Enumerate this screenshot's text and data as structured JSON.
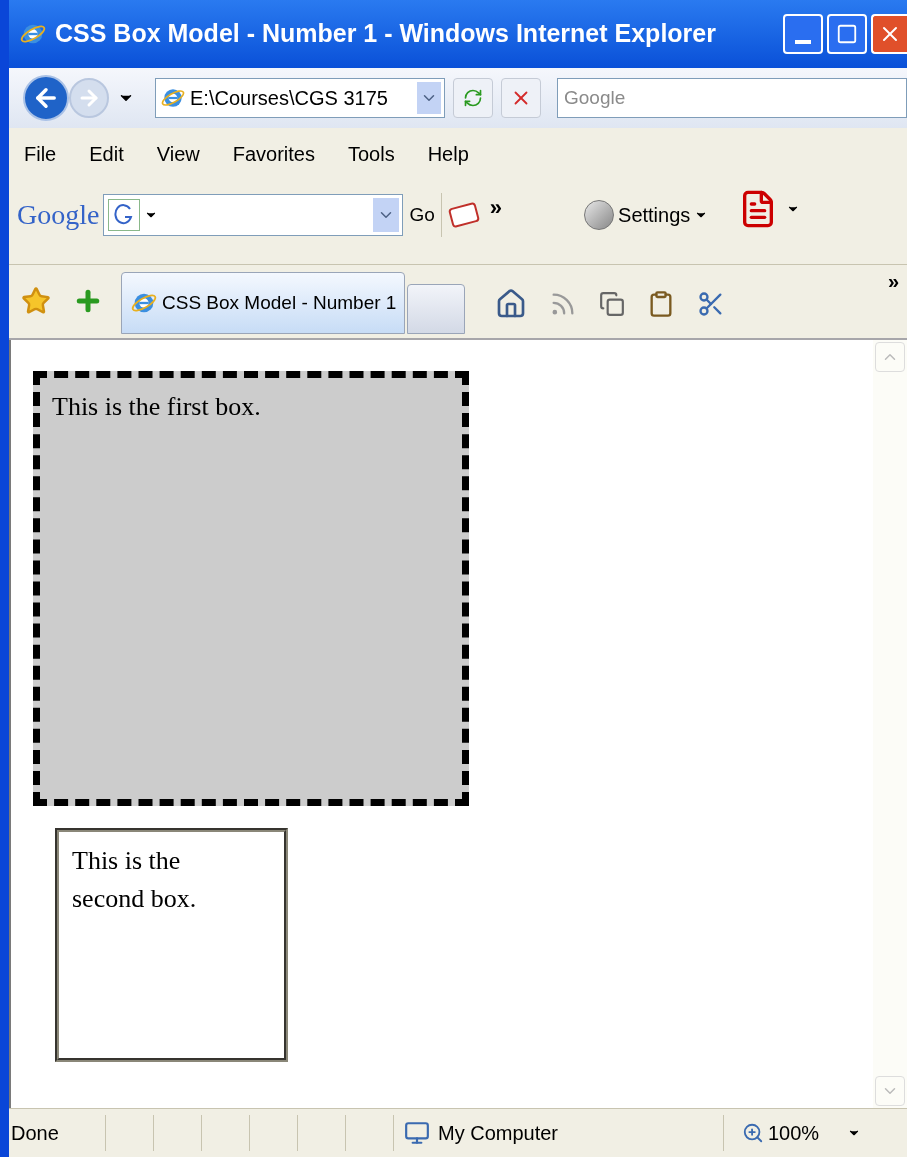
{
  "window": {
    "title": "CSS Box Model - Number 1 - Windows Internet Explorer"
  },
  "address_bar": {
    "value": "E:\\Courses\\CGS 3175"
  },
  "search": {
    "placeholder": "Google"
  },
  "menu": [
    "File",
    "Edit",
    "View",
    "Favorites",
    "Tools",
    "Help"
  ],
  "google_toolbar": {
    "logo": "Google",
    "go": "Go",
    "more": "»",
    "settings": "Settings"
  },
  "tabs": [
    {
      "label": "CSS Box Model - Number 1",
      "selected": true
    }
  ],
  "command_bar": {
    "more": "»"
  },
  "page": {
    "boxes": [
      {
        "kind": "dashed",
        "text": "This is the first box."
      },
      {
        "kind": "groove",
        "text": "This is the second box."
      }
    ]
  },
  "status_bar": {
    "text": "Done",
    "zone": "My Computer",
    "zoom": "100%"
  }
}
